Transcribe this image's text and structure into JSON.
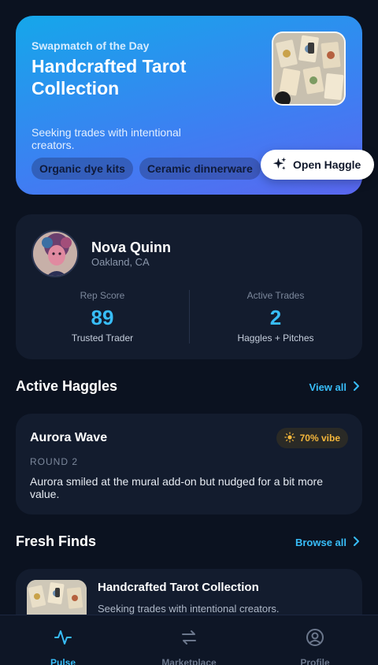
{
  "hero": {
    "kicker": "Swapmatch of the Day",
    "title": "Handcrafted Tarot Collection",
    "subtitle": "Seeking trades with intentional creators.",
    "tags": [
      "Organic dye kits",
      "Ceramic dinnerware"
    ],
    "cta_label": "Open Haggle",
    "cta_icon": "sparkles-icon"
  },
  "profile": {
    "name": "Nova Quinn",
    "location": "Oakland, CA",
    "stats": [
      {
        "label": "Rep Score",
        "value": "89",
        "caption": "Trusted Trader"
      },
      {
        "label": "Active Trades",
        "value": "2",
        "caption": "Haggles + Pitches"
      }
    ]
  },
  "active_haggles": {
    "title": "Active Haggles",
    "link_label": "View all",
    "items": [
      {
        "name": "Aurora Wave",
        "vibe": "70% vibe",
        "round": "ROUND 2",
        "message": "Aurora smiled at the mural add-on but nudged for a bit more value."
      }
    ]
  },
  "fresh_finds": {
    "title": "Fresh Finds",
    "link_label": "Browse all",
    "items": [
      {
        "title": "Handcrafted Tarot Collection",
        "subtitle": "Seeking trades with intentional creators."
      }
    ]
  },
  "nav": {
    "items": [
      {
        "label": "Pulse",
        "icon": "activity-icon",
        "active": true
      },
      {
        "label": "Marketplace",
        "icon": "swap-arrows-icon",
        "active": false
      },
      {
        "label": "Profile",
        "icon": "user-circle-icon",
        "active": false
      }
    ]
  },
  "colors": {
    "accent": "#38bdf8",
    "background": "#0b1220",
    "card": "#131c2e",
    "vibe": "#f5b73b"
  }
}
